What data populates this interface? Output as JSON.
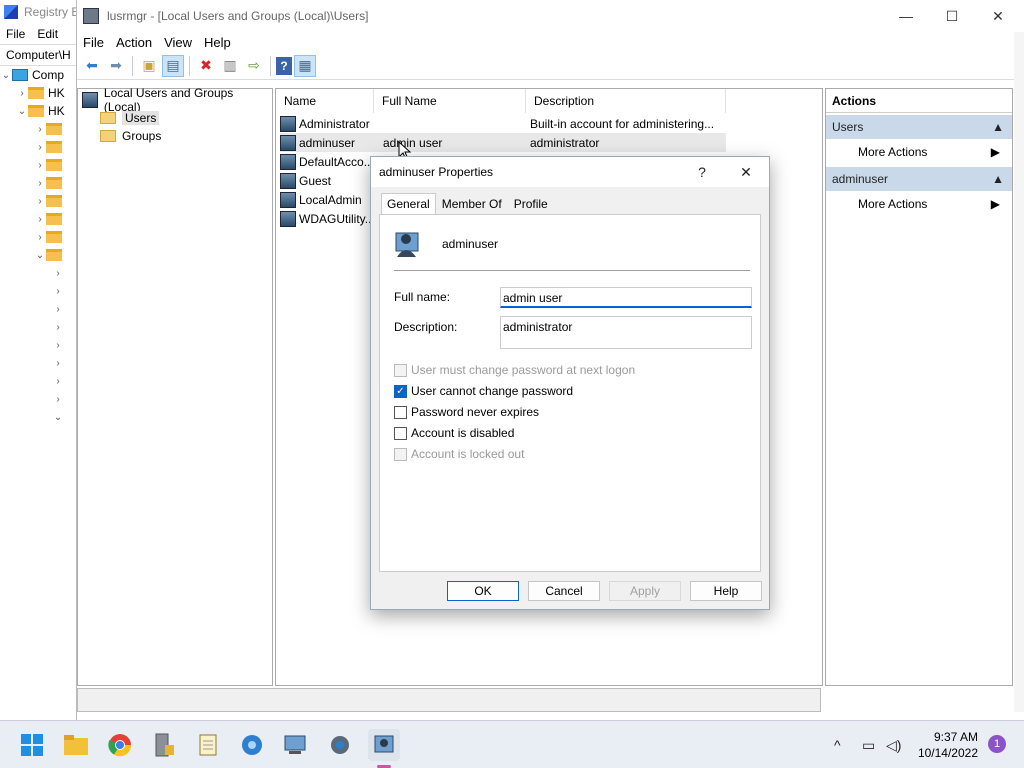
{
  "registry": {
    "title": "Registry E",
    "menu": [
      "File",
      "Edit"
    ],
    "address": "Computer\\H",
    "tree": [
      {
        "label": "Comp",
        "type": "pc"
      },
      {
        "label": "HK",
        "type": "folder"
      },
      {
        "label": "HK",
        "type": "folder"
      }
    ]
  },
  "window": {
    "title": "lusrmgr - [Local Users and Groups (Local)\\Users]",
    "minimize_icon": "minimize-icon",
    "maximize_icon": "maximize-icon",
    "close_icon": "close-icon"
  },
  "menubar": [
    "File",
    "Action",
    "View",
    "Help"
  ],
  "toolbar": [
    "back-icon",
    "forward-icon",
    "up-folder-icon",
    "show-tree-icon",
    "delete-icon",
    "properties-icon",
    "export-icon",
    "help-icon",
    "action-pane-icon"
  ],
  "tree": {
    "root": "Local Users and Groups (Local)",
    "items": [
      "Users",
      "Groups"
    ]
  },
  "list": {
    "columns": [
      "Name",
      "Full Name",
      "Description"
    ],
    "rows": [
      {
        "name": "Administrator",
        "full_name": "",
        "description": "Built-in account for administering..."
      },
      {
        "name": "adminuser",
        "full_name": "admin user",
        "description": "administrator"
      },
      {
        "name": "DefaultAcco...",
        "full_name": "",
        "description": ""
      },
      {
        "name": "Guest",
        "full_name": "",
        "description": ""
      },
      {
        "name": "LocalAdmin",
        "full_name": "",
        "description": ""
      },
      {
        "name": "WDAGUtility...",
        "full_name": "",
        "description": ""
      }
    ]
  },
  "actions": {
    "header": "Actions",
    "sections": [
      {
        "title": "Users",
        "item": "More Actions"
      },
      {
        "title": "adminuser",
        "item": "More Actions"
      }
    ]
  },
  "dialog": {
    "title": "adminuser Properties",
    "help_glyph": "?",
    "tabs": [
      "General",
      "Member Of",
      "Profile"
    ],
    "username": "adminuser",
    "full_name_label": "Full name:",
    "full_name_value": "admin user",
    "description_label": "Description:",
    "description_value": "administrator",
    "checkboxes": [
      {
        "label": "User must change password at next logon",
        "checked": false,
        "enabled": false
      },
      {
        "label": "User cannot change password",
        "checked": true,
        "enabled": true
      },
      {
        "label": "Password never expires",
        "checked": false,
        "enabled": true
      },
      {
        "label": "Account is disabled",
        "checked": false,
        "enabled": true
      },
      {
        "label": "Account is locked out",
        "checked": false,
        "enabled": false
      }
    ],
    "buttons": {
      "ok": "OK",
      "cancel": "Cancel",
      "apply": "Apply",
      "help": "Help"
    }
  },
  "taskbar": {
    "apps": [
      "start-icon",
      "file-explorer-icon",
      "chrome-icon",
      "server-manager-icon",
      "notepad-icon",
      "network-icon",
      "computer-management-icon",
      "settings-icon",
      "lusrmgr-icon"
    ],
    "time": "9:37 AM",
    "date": "10/14/2022",
    "notifications": "1"
  },
  "colors": {
    "accent": "#0c63c7",
    "action_header": "#c9d9ea"
  }
}
